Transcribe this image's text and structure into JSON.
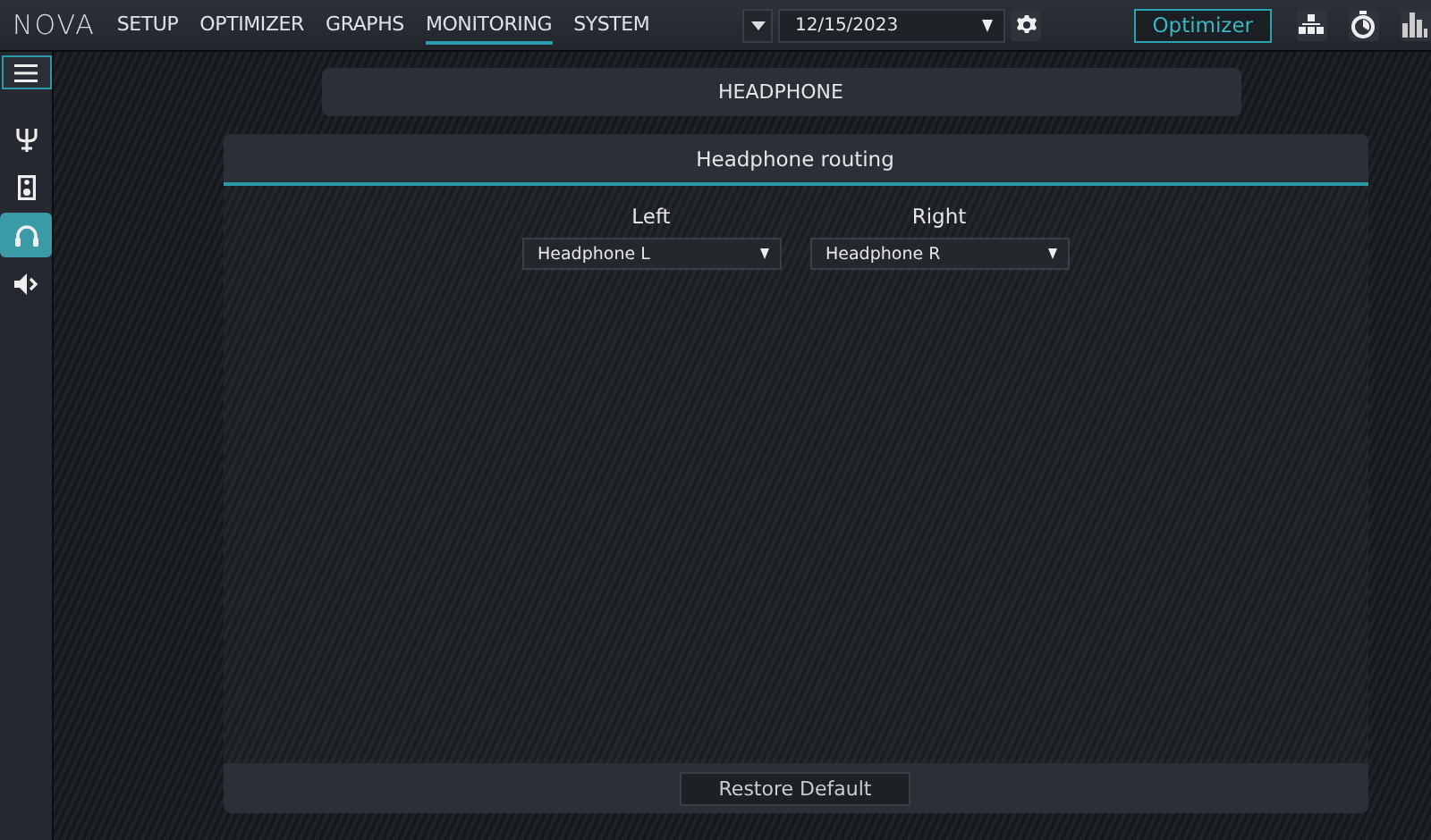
{
  "logo": "NOVA",
  "nav": [
    {
      "label": "SETUP",
      "selected": false
    },
    {
      "label": "OPTIMIZER",
      "selected": false
    },
    {
      "label": "GRAPHS",
      "selected": false
    },
    {
      "label": "MONITORING",
      "selected": true
    },
    {
      "label": "SYSTEM",
      "selected": false
    }
  ],
  "date": {
    "value": "12/15/2023"
  },
  "optimizer_button": "Optimizer",
  "sidebar": {
    "items": [
      {
        "kind": "tuning",
        "selected": false
      },
      {
        "kind": "speaker",
        "selected": false
      },
      {
        "kind": "headphone",
        "selected": true
      },
      {
        "kind": "volume",
        "selected": false
      }
    ]
  },
  "section_title": "HEADPHONE",
  "panel": {
    "title": "Headphone routing",
    "channels": [
      {
        "label": "Left",
        "value": "Headphone L"
      },
      {
        "label": "Right",
        "value": "Headphone R"
      }
    ],
    "button": "Restore Default"
  }
}
